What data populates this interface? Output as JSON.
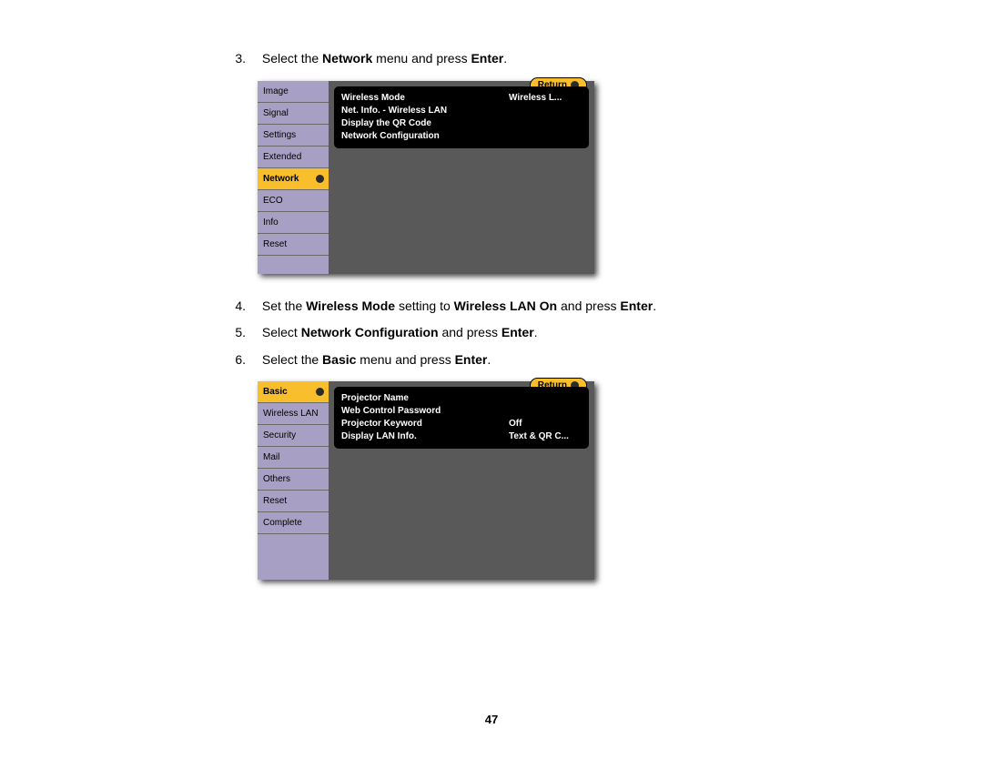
{
  "page_number": "47",
  "steps": {
    "s3": {
      "num": "3.",
      "pre": "Select the ",
      "b1": "Network",
      "mid": " menu and press ",
      "b2": "Enter",
      "post": "."
    },
    "s4": {
      "num": "4.",
      "pre": "Set the ",
      "b1": "Wireless Mode",
      "mid1": " setting to ",
      "b2": "Wireless LAN On",
      "mid2": " and press ",
      "b3": "Enter",
      "post": "."
    },
    "s5": {
      "num": "5.",
      "pre": "Select ",
      "b1": "Network Configuration",
      "mid": " and press ",
      "b2": "Enter",
      "post": "."
    },
    "s6": {
      "num": "6.",
      "pre": "Select the ",
      "b1": "Basic",
      "mid": " menu and press ",
      "b2": "Enter",
      "post": "."
    }
  },
  "return_label": "Return",
  "menu1": {
    "sidebar": [
      "Image",
      "Signal",
      "Settings",
      "Extended",
      "Network",
      "ECO",
      "Info",
      "Reset"
    ],
    "selected_index": 4,
    "panel": [
      {
        "label": "Wireless Mode",
        "value": "Wireless L..."
      },
      {
        "label": "Net. Info. - Wireless LAN",
        "value": ""
      },
      {
        "label": "Display the QR Code",
        "value": ""
      },
      {
        "label": "Network Configuration",
        "value": ""
      }
    ]
  },
  "menu2": {
    "sidebar": [
      "Basic",
      "Wireless LAN",
      "Security",
      "Mail",
      "Others",
      "Reset",
      "Complete"
    ],
    "selected_index": 0,
    "panel": [
      {
        "label": "Projector Name",
        "value": ""
      },
      {
        "label": "Web Control Password",
        "value": ""
      },
      {
        "label": "Projector Keyword",
        "value": "Off"
      },
      {
        "label": "Display LAN Info.",
        "value": "Text & QR C..."
      }
    ]
  }
}
